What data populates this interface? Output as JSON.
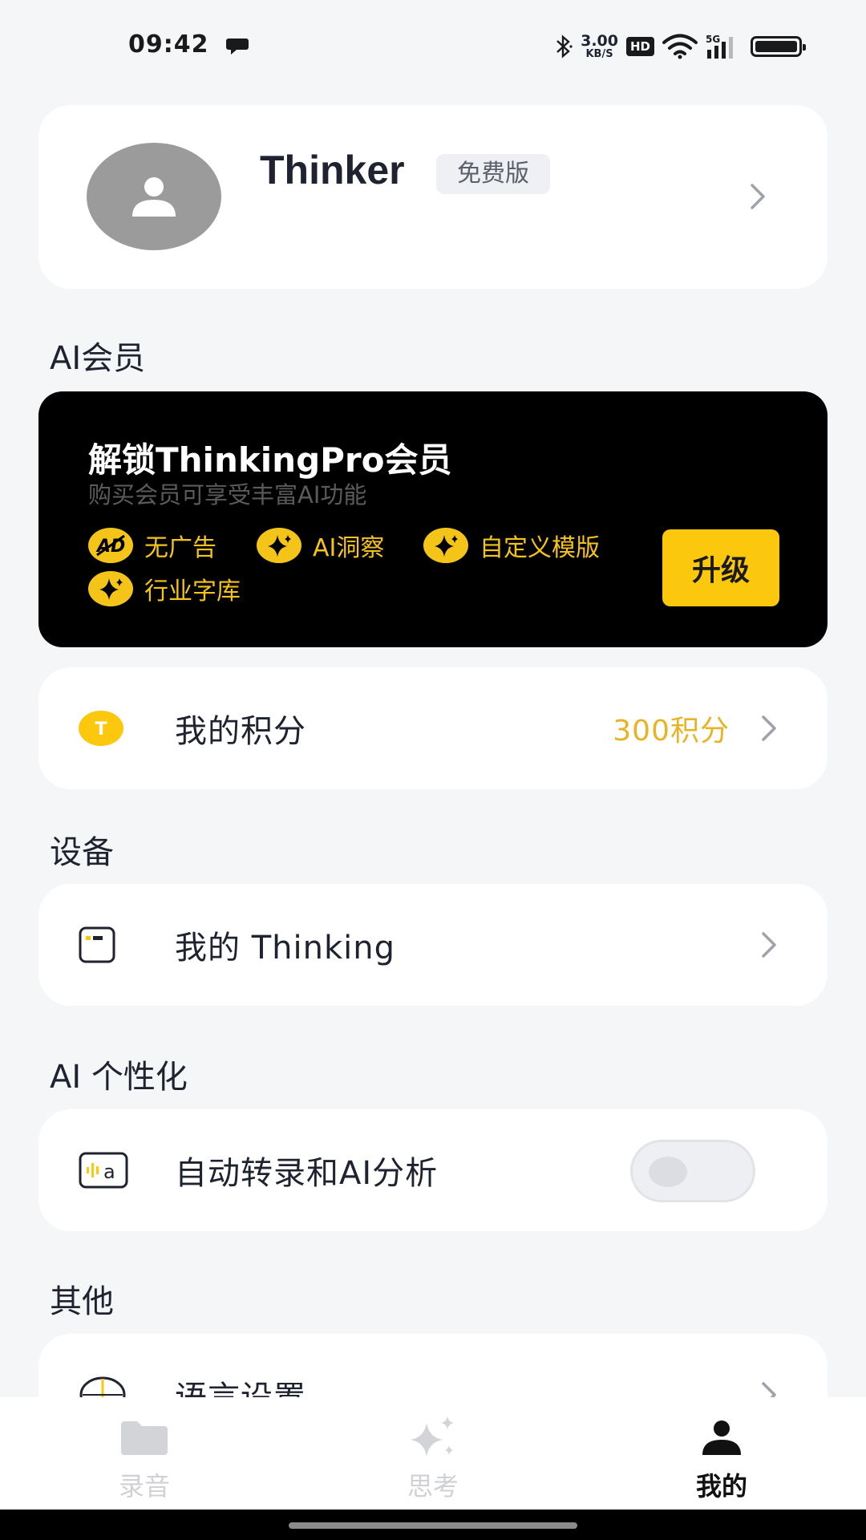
{
  "status_bar": {
    "time": "09:42",
    "net_speed_value": "3.00",
    "net_speed_unit": "KB/S",
    "hd": "HD",
    "network": "5G"
  },
  "profile": {
    "name": "Thinker",
    "plan": "免费版"
  },
  "sections": {
    "ai_member": "AI会员",
    "devices": "设备",
    "ai_personalization": "AI 个性化",
    "others": "其他"
  },
  "membership": {
    "title": "解锁ThinkingPro会员",
    "subtitle": "购买会员可享受丰富AI功能",
    "features": [
      "无广告",
      "AI洞察",
      "自定义模版",
      "行业字库"
    ],
    "upgrade_label": "升级"
  },
  "points": {
    "label": "我的积分",
    "value": "300积分",
    "icon_letter": "T"
  },
  "device": {
    "label": "我的 Thinking"
  },
  "auto_transcribe": {
    "label": "自动转录和AI分析",
    "enabled": false
  },
  "language": {
    "label": "语言设置"
  },
  "nav": {
    "items": [
      {
        "label": "录音",
        "icon": "folder-icon",
        "active": false
      },
      {
        "label": "思考",
        "icon": "sparkle-icon",
        "active": false
      },
      {
        "label": "我的",
        "icon": "person-icon",
        "active": true
      }
    ]
  },
  "colors": {
    "accent": "#fcc80e",
    "points_text": "#e8b325",
    "background": "#f5f6f8"
  }
}
